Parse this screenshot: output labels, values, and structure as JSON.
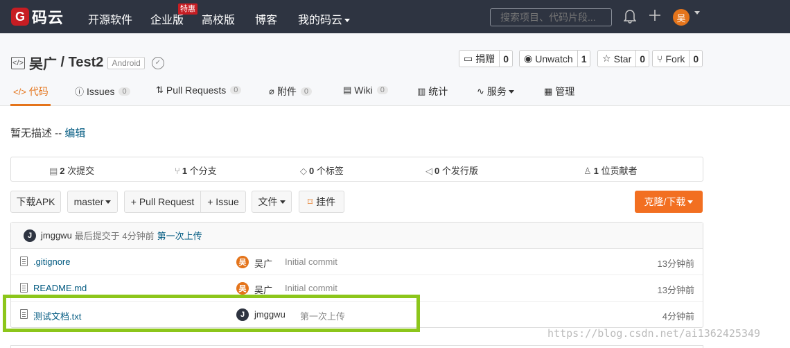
{
  "nav": {
    "logo_mark": "G",
    "logo_text": "码云",
    "links": [
      "开源软件",
      "企业版",
      "高校版",
      "博客",
      "我的码云"
    ],
    "hot_badge": "特惠",
    "search_placeholder": "搜索项目、代码片段...",
    "avatar": "吴"
  },
  "repo": {
    "owner": "吴广",
    "separator": " / ",
    "name": "Test2",
    "tag": "Android",
    "actions": [
      {
        "label": "捐赠",
        "count": "0",
        "icon": "gift-icon"
      },
      {
        "label": "Unwatch",
        "count": "1",
        "icon": "eye-icon"
      },
      {
        "label": "Star",
        "count": "0",
        "icon": "star-icon"
      },
      {
        "label": "Fork",
        "count": "0",
        "icon": "fork-icon"
      }
    ]
  },
  "tabs": [
    {
      "label": "代码",
      "count": null
    },
    {
      "label": "Issues",
      "count": "0"
    },
    {
      "label": "Pull Requests",
      "count": "0"
    },
    {
      "label": "附件",
      "count": "0"
    },
    {
      "label": "Wiki",
      "count": "0"
    },
    {
      "label": "统计",
      "count": null
    },
    {
      "label": "服务",
      "count": null
    },
    {
      "label": "管理",
      "count": null
    }
  ],
  "description": {
    "text": "暂无描述 -- ",
    "edit": "编辑"
  },
  "stats": [
    {
      "num": "2",
      "label": " 次提交"
    },
    {
      "num": "1",
      "label": " 个分支"
    },
    {
      "num": "0",
      "label": " 个标签"
    },
    {
      "num": "0",
      "label": " 个发行版"
    },
    {
      "num": "1",
      "label": " 位贡献者"
    }
  ],
  "buttons": {
    "download_apk": "下载APK",
    "branch": "master",
    "pull_request": "+ Pull Request",
    "issue": "+ Issue",
    "files": "文件",
    "pendant": "挂件",
    "clone": "克隆/下载"
  },
  "last_commit": {
    "avatar": "J",
    "user": "jmggwu",
    "meta": "最后提交于 4分钟前",
    "message": "第一次上传"
  },
  "files": [
    {
      "name": ".gitignore",
      "avatar": "吴",
      "user": "吴广",
      "message": "Initial commit",
      "time": "13分钟前"
    },
    {
      "name": "README.md",
      "avatar": "吴",
      "user": "吴广",
      "message": "Initial commit",
      "time": "13分钟前"
    },
    {
      "name": "测试文档.txt",
      "avatar": "J",
      "user": "jmggwu",
      "message": "第一次上传",
      "time": "4分钟前"
    }
  ],
  "watermark": "https://blog.csdn.net/ai1362425349",
  "colors": {
    "topbar": "#2e3441",
    "accent": "#e4741b",
    "link": "#005980",
    "highlight": "#8cc61b",
    "clone_button": "#f26f21"
  }
}
